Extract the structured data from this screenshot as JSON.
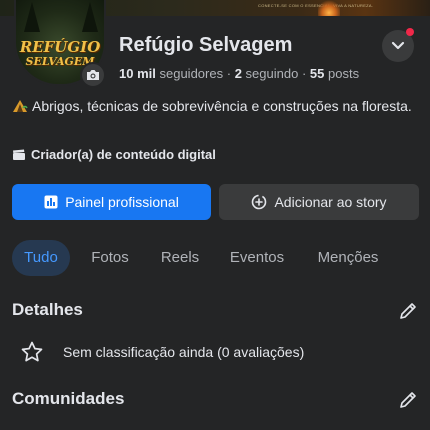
{
  "cover": {
    "tagline": "CONECTE-SE COM O ESSENCIAL. VIVA A NATUREZA."
  },
  "avatar": {
    "logo_line1": "REFÚGIO",
    "logo_line2": "SELVAGEM"
  },
  "profile": {
    "name": "Refúgio Selvagem",
    "followers_count": "10 mil",
    "followers_label": "seguidores",
    "following_count": "2",
    "following_label": "seguindo",
    "posts_count": "55",
    "posts_label": "posts",
    "separator": "·",
    "bio": "Abrigos, técnicas de sobrevivência e construções na floresta.",
    "category": "Criador(a) de conteúdo digital"
  },
  "actions": {
    "primary_label": "Painel profissional",
    "secondary_label": "Adicionar ao story"
  },
  "tabs": [
    {
      "label": "Tudo",
      "active": true
    },
    {
      "label": "Fotos",
      "active": false
    },
    {
      "label": "Reels",
      "active": false
    },
    {
      "label": "Eventos",
      "active": false
    },
    {
      "label": "Menções",
      "active": false
    }
  ],
  "details": {
    "title": "Detalhes",
    "rating_text": "Sem classificação ainda (0 avaliações)"
  },
  "communities": {
    "title": "Comunidades"
  },
  "colors": {
    "background": "#242526",
    "accent": "#1877f2",
    "active_tab_bg": "#263951",
    "active_tab_text": "#4599ff",
    "notification_dot": "#f02849"
  },
  "icons": {
    "camera": "camera-icon",
    "chevron": "chevron-down-icon",
    "bio": "camp-icon",
    "category": "clapperboard-icon",
    "dashboard": "bar-chart-icon",
    "add_story": "add-circle-icon",
    "edit": "pencil-icon",
    "rating": "star-icon"
  }
}
